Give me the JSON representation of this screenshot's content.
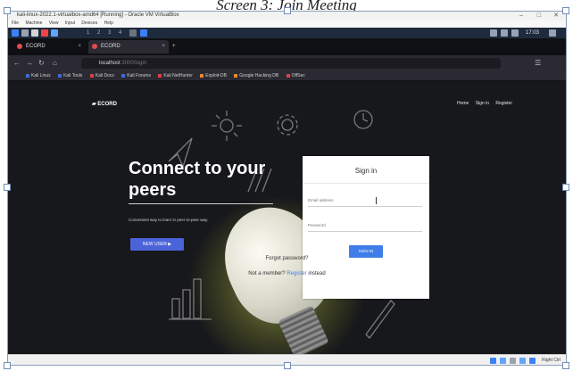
{
  "document": {
    "caption": "Screen 3: Join Meeting"
  },
  "vbox": {
    "title": "kali-linux-2022.1-virtualbox-amd64 [Running] - Oracle VM VirtualBox",
    "min_btn": "–",
    "max_btn": "□",
    "close_btn": "✕",
    "menu": [
      "File",
      "Machine",
      "View",
      "Input",
      "Devices",
      "Help"
    ]
  },
  "kali_panel": {
    "workspaces": [
      "1",
      "2",
      "3",
      "4"
    ],
    "clock": "17:03"
  },
  "browser": {
    "tabs": [
      {
        "label": "ECORD",
        "active": false
      },
      {
        "label": "ECORD",
        "active": true
      }
    ],
    "new_tab": "+",
    "url_host": "localhost",
    "url_path": ":3000/login",
    "bookmarks": [
      "Kali Linux",
      "Kali Tools",
      "Kali Docs",
      "Kali Forums",
      "Kali NetHunter",
      "Exploit-DB",
      "Google Hacking DB",
      "OffSec"
    ]
  },
  "page": {
    "brand": "ECORD",
    "nav": [
      "Home",
      "Sign in",
      "Register"
    ],
    "hero_title": "Connect to your peers",
    "hero_subtitle": "Convenient way to learn in peer-to-peer way.",
    "hero_button": "NEW USER",
    "signin": {
      "title": "Sign in",
      "email_placeholder": "Email address",
      "password_placeholder": "Password",
      "button": "SIGN IN",
      "forgot": "Forgot password?",
      "member_text": "Not a member?",
      "register_link": "Register",
      "instead": "instead"
    }
  },
  "taskbar": {
    "right_text": "Right Ctrl"
  },
  "colors": {
    "accent_blue": "#3f7ee8",
    "hero_button": "#4a63d8",
    "page_bg": "#17181b"
  }
}
